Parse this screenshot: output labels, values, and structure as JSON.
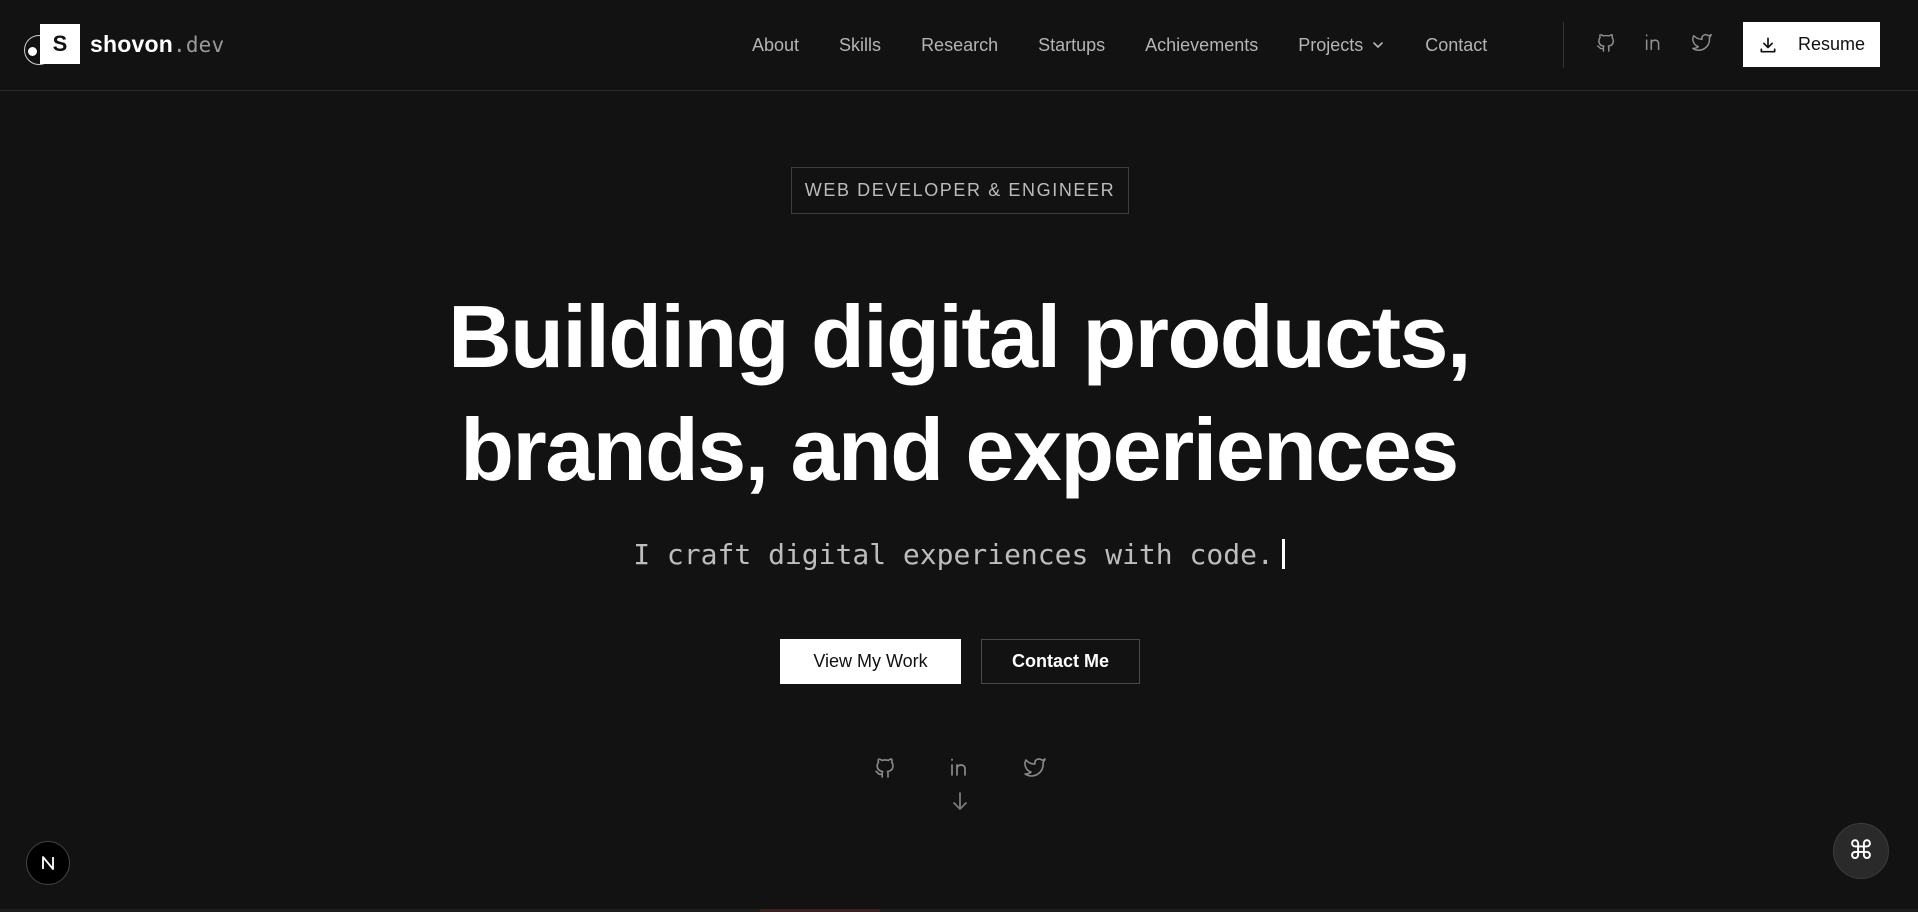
{
  "brand": {
    "mark": "S",
    "name": "shovon",
    "tld": ".dev"
  },
  "nav": {
    "items": [
      {
        "label": "About"
      },
      {
        "label": "Skills"
      },
      {
        "label": "Research"
      },
      {
        "label": "Startups"
      },
      {
        "label": "Achievements"
      },
      {
        "label": "Projects",
        "has_dropdown": true
      },
      {
        "label": "Contact"
      }
    ],
    "resume_label": "Resume"
  },
  "social": [
    "github-icon",
    "linkedin-icon",
    "twitter-icon"
  ],
  "hero": {
    "tag": "WEB DEVELOPER & ENGINEER",
    "title_line1": "Building digital products,",
    "title_line2": "brands, and experiences",
    "typed_text": "I craft digital experiences with code.",
    "primary_cta": "View My Work",
    "secondary_cta": "Contact Me"
  },
  "badges": {
    "next_badge": "N",
    "command_glyph": "⌘"
  },
  "colors": {
    "background": "#121212",
    "text": "#ffffff",
    "muted": "#b4b4b4",
    "border": "#2c2c2c"
  }
}
